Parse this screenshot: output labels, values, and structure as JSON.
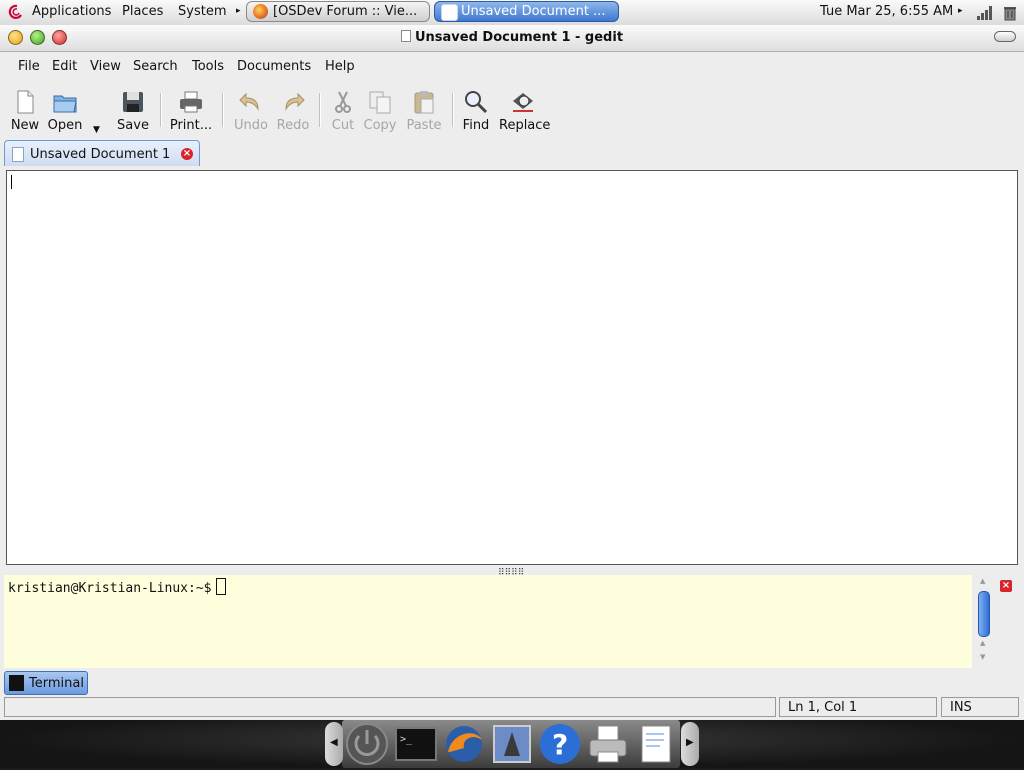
{
  "top_panel": {
    "menus": [
      "Applications",
      "Places",
      "System"
    ],
    "tasks": [
      {
        "label": "[OSDev Forum :: Vie...",
        "active": false
      },
      {
        "label": "Unsaved Document ...",
        "active": true
      }
    ],
    "clock": "Tue Mar 25,  6:55 AM"
  },
  "window": {
    "title": "Unsaved Document 1 - gedit",
    "menubar": [
      "File",
      "Edit",
      "View",
      "Search",
      "Tools",
      "Documents",
      "Help"
    ],
    "toolbar": [
      {
        "label": "New",
        "icon": "new-document-icon",
        "enabled": true
      },
      {
        "label": "Open",
        "icon": "open-folder-icon",
        "enabled": true
      },
      {
        "label": "Save",
        "icon": "save-icon",
        "enabled": true
      },
      {
        "label": "Print...",
        "icon": "print-icon",
        "enabled": true
      },
      {
        "label": "Undo",
        "icon": "undo-icon",
        "enabled": false
      },
      {
        "label": "Redo",
        "icon": "redo-icon",
        "enabled": false
      },
      {
        "label": "Cut",
        "icon": "cut-icon",
        "enabled": false
      },
      {
        "label": "Copy",
        "icon": "copy-icon",
        "enabled": false
      },
      {
        "label": "Paste",
        "icon": "paste-icon",
        "enabled": false
      },
      {
        "label": "Find",
        "icon": "find-icon",
        "enabled": true
      },
      {
        "label": "Replace",
        "icon": "replace-icon",
        "enabled": true
      }
    ],
    "document_tab": "Unsaved Document 1",
    "editor_text": "",
    "terminal": {
      "prompt": "kristian@Kristian-Linux:~$",
      "tab_label": "Terminal"
    },
    "status": {
      "position": "Ln 1, Col 1",
      "mode": "INS"
    }
  },
  "colors": {
    "accent": "#3e78cf",
    "terminal_bg": "#ffffdd",
    "close_red": "#d8252c"
  }
}
